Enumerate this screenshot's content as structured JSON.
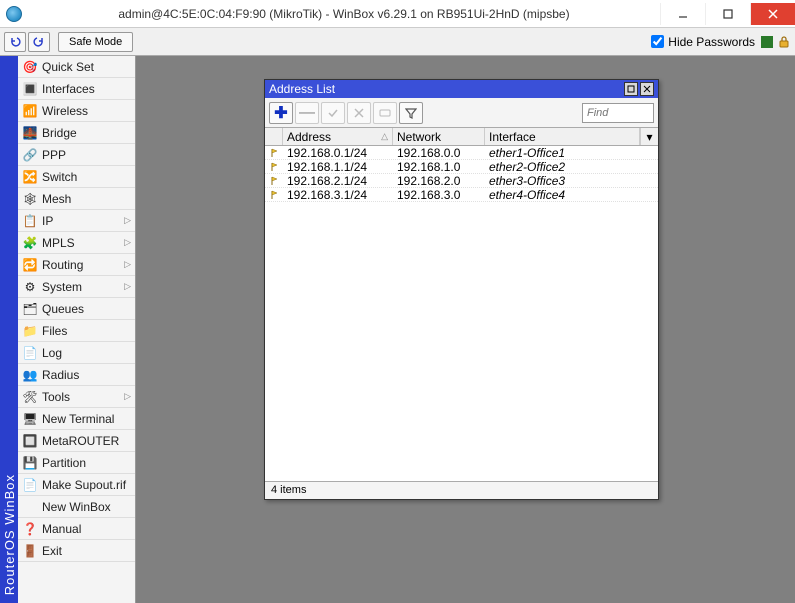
{
  "titlebar": {
    "text": "admin@4C:5E:0C:04:F9:90 (MikroTik) - WinBox v6.29.1 on RB951Ui-2HnD (mipsbe)"
  },
  "toolbar": {
    "safe_mode": "Safe Mode",
    "hide_passwords": "Hide Passwords"
  },
  "brand_vertical": "RouterOS WinBox",
  "sidebar": {
    "items": [
      {
        "label": "Quick Set",
        "icon": "🎯",
        "chev": false
      },
      {
        "label": "Interfaces",
        "icon": "🔳",
        "chev": false
      },
      {
        "label": "Wireless",
        "icon": "📶",
        "chev": false
      },
      {
        "label": "Bridge",
        "icon": "🌉",
        "chev": false
      },
      {
        "label": "PPP",
        "icon": "🔗",
        "chev": false
      },
      {
        "label": "Switch",
        "icon": "🔀",
        "chev": false
      },
      {
        "label": "Mesh",
        "icon": "🕸",
        "chev": false
      },
      {
        "label": "IP",
        "icon": "📋",
        "chev": true
      },
      {
        "label": "MPLS",
        "icon": "🧩",
        "chev": true
      },
      {
        "label": "Routing",
        "icon": "🔁",
        "chev": true
      },
      {
        "label": "System",
        "icon": "⚙",
        "chev": true
      },
      {
        "label": "Queues",
        "icon": "🗂",
        "chev": false
      },
      {
        "label": "Files",
        "icon": "📁",
        "chev": false
      },
      {
        "label": "Log",
        "icon": "📄",
        "chev": false
      },
      {
        "label": "Radius",
        "icon": "👥",
        "chev": false
      },
      {
        "label": "Tools",
        "icon": "🛠",
        "chev": true
      },
      {
        "label": "New Terminal",
        "icon": "🖥",
        "chev": false
      },
      {
        "label": "MetaROUTER",
        "icon": "🔲",
        "chev": false
      },
      {
        "label": "Partition",
        "icon": "💾",
        "chev": false
      },
      {
        "label": "Make Supout.rif",
        "icon": "📄",
        "chev": false
      },
      {
        "label": "New WinBox",
        "icon": "",
        "chev": false
      },
      {
        "label": "Manual",
        "icon": "❓",
        "chev": false
      },
      {
        "label": "Exit",
        "icon": "🚪",
        "chev": false
      }
    ]
  },
  "inner_window": {
    "title": "Address List",
    "find_placeholder": "Find",
    "columns": {
      "address": "Address",
      "network": "Network",
      "interface": "Interface"
    },
    "rows": [
      {
        "address": "192.168.0.1/24",
        "network": "192.168.0.0",
        "interface": "ether1-Office1"
      },
      {
        "address": "192.168.1.1/24",
        "network": "192.168.1.0",
        "interface": "ether2-Office2"
      },
      {
        "address": "192.168.2.1/24",
        "network": "192.168.2.0",
        "interface": "ether3-Office3"
      },
      {
        "address": "192.168.3.1/24",
        "network": "192.168.3.0",
        "interface": "ether4-Office4"
      }
    ],
    "status": "4 items"
  }
}
